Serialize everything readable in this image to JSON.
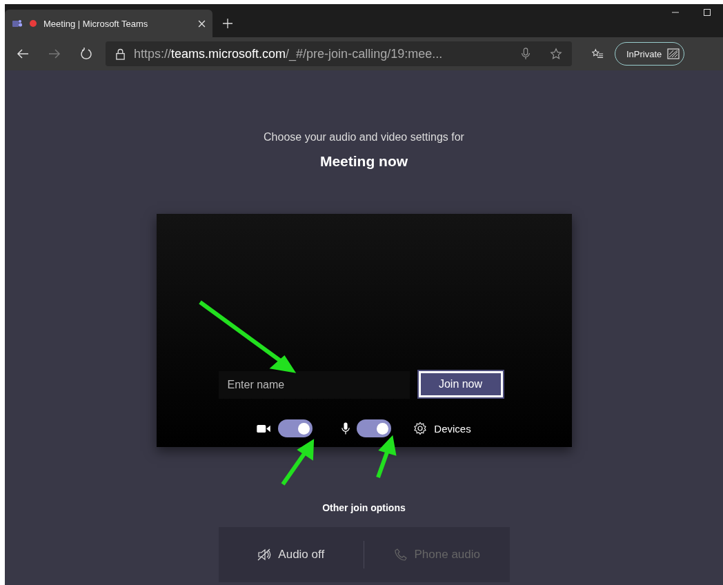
{
  "browser": {
    "tab": {
      "title": "Meeting | Microsoft Teams",
      "recording": true
    },
    "url": {
      "scheme": "https://",
      "host": "teams.microsoft.com",
      "path": "/_#/pre-join-calling/19:mee..."
    },
    "profile": "InPrivate"
  },
  "prejoin": {
    "heading": "Choose your audio and video settings for",
    "meeting_title": "Meeting now",
    "name_field": {
      "placeholder": "Enter name"
    },
    "join_button": "Join now",
    "camera": {
      "on": true
    },
    "microphone": {
      "on": true
    },
    "devices": "Devices"
  },
  "other_options": {
    "heading": "Other join options",
    "options": [
      {
        "kind": "audio-off",
        "label": "Audio off",
        "disabled": false
      },
      {
        "kind": "phone",
        "label": "Phone audio",
        "disabled": true
      }
    ]
  }
}
